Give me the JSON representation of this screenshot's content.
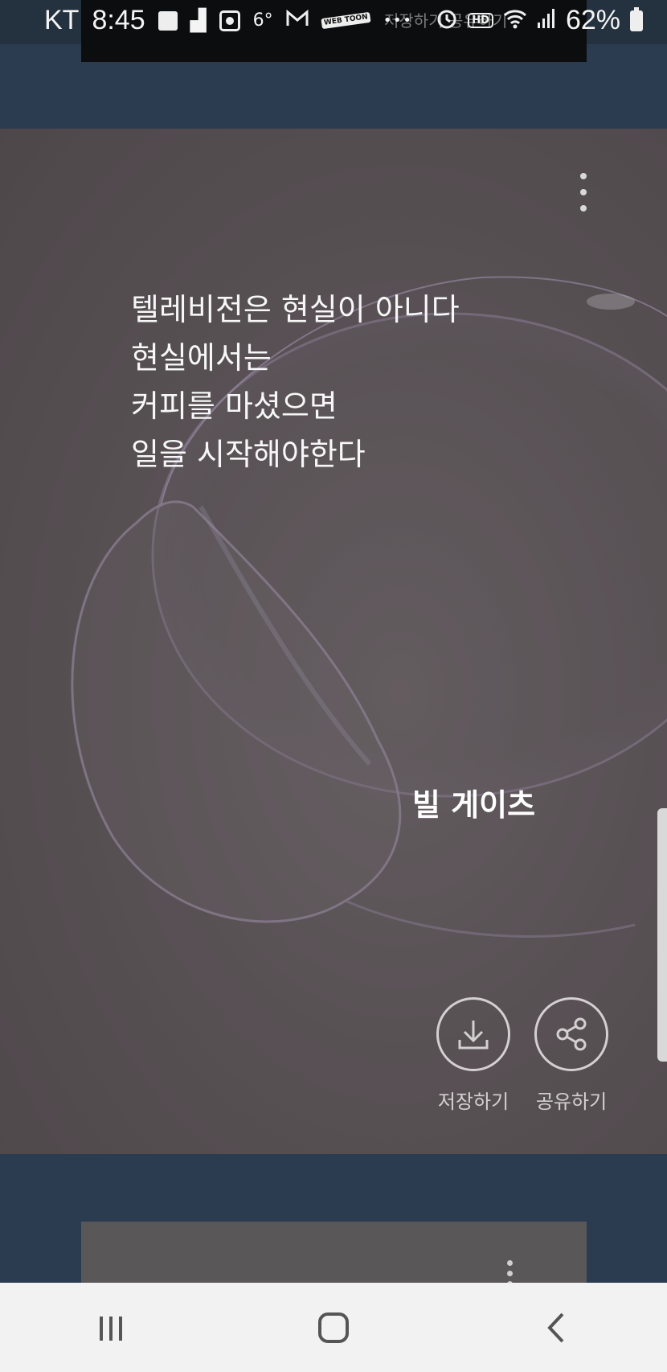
{
  "status_bar": {
    "carrier": "KT",
    "time": "8:45",
    "temperature": "6°",
    "webtoon_icon_text": "WEB TOON",
    "more_dots": "• • •",
    "ghost_text": "저장하기 공유하기",
    "hd_badge": "HD",
    "battery_percent": "62%",
    "icons": [
      "sticky-note-icon",
      "steps-icon",
      "record-icon",
      "temperature-icon",
      "gmail-icon",
      "webtoon-icon",
      "alarm-icon",
      "hd-call-icon",
      "wifi-icon",
      "signal-icon",
      "battery-icon"
    ]
  },
  "card": {
    "quote_lines": [
      "텔레비전은 현실이 아니다",
      "현실에서는",
      "커피를 마셨으면",
      "일을 시작해야한다"
    ],
    "author": "빌 게이츠",
    "save_label": "저장하기",
    "share_label": "공유하기"
  },
  "navbar": {
    "icons": [
      "recent-apps-icon",
      "home-icon",
      "back-icon"
    ]
  },
  "colors": {
    "page_background": "#2c3c50",
    "card_background": "#5d5659",
    "text": "#ffffff",
    "nav_background": "#f2f2f2"
  }
}
